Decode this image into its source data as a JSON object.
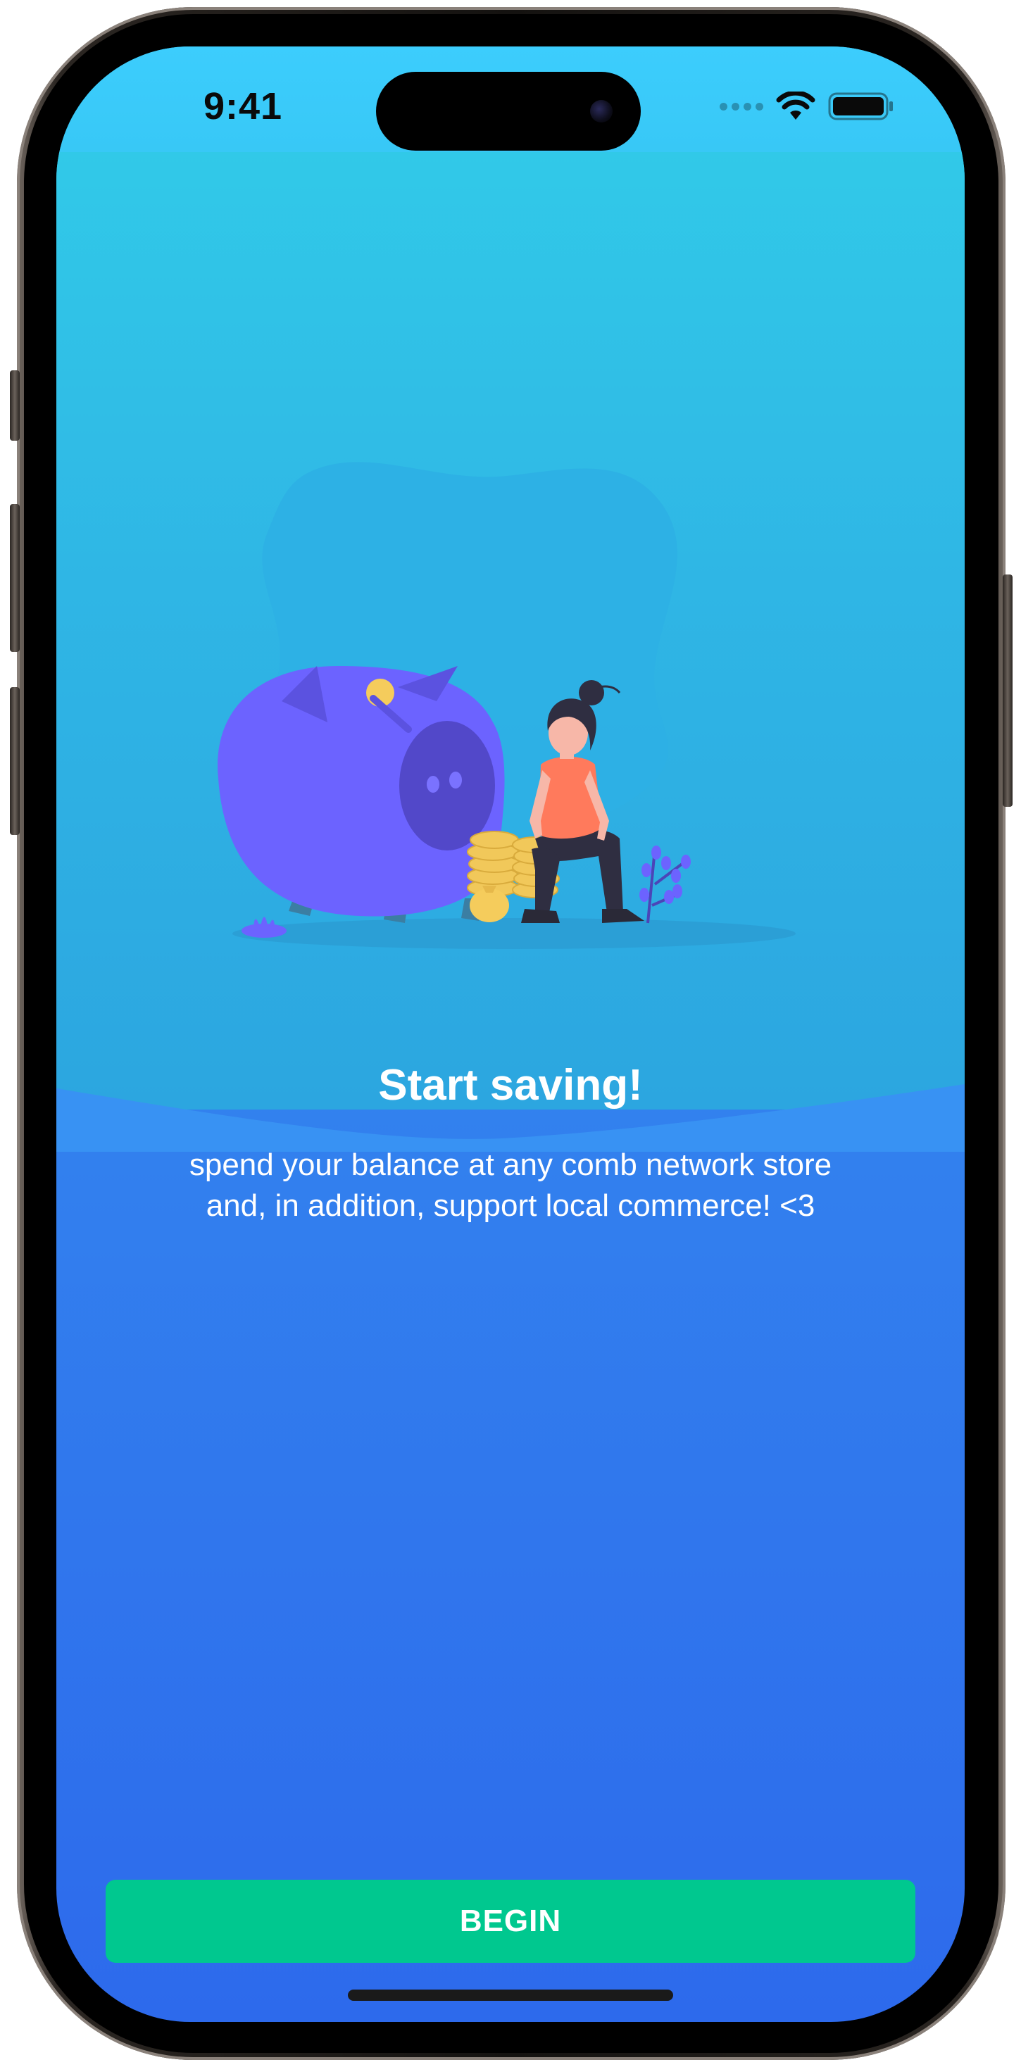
{
  "status_bar": {
    "time": "9:41",
    "icons": [
      "cellular-signal-icon",
      "wifi-icon",
      "battery-icon"
    ]
  },
  "onboarding": {
    "illustration": "piggy-bank-savings-illustration",
    "title": "Start saving!",
    "description": "spend your balance at any comb network store and, in addition, support local commerce! <3"
  },
  "actions": {
    "begin_label": "BEGIN"
  },
  "colors": {
    "top_gradient": "#36c5ec",
    "bottom_gradient": "#2d6aec",
    "button": "#00c88f",
    "piggy": "#6c63ff",
    "text": "#ffffff"
  }
}
